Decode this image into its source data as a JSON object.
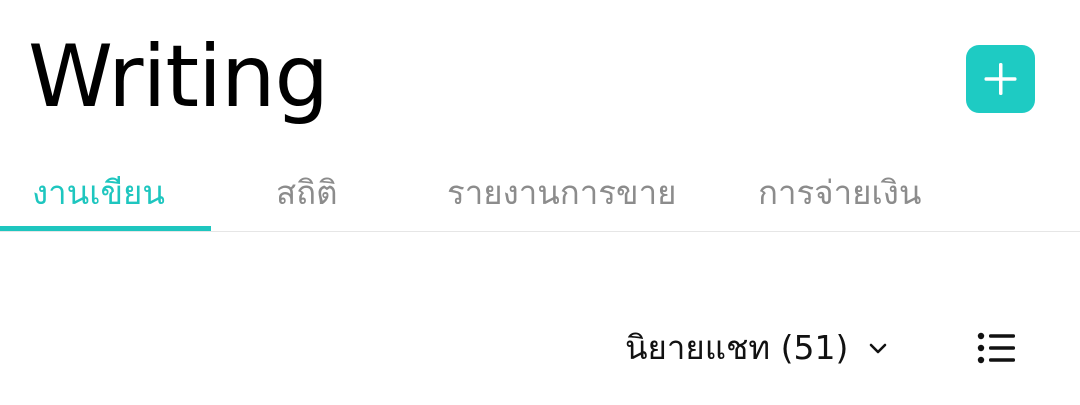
{
  "header": {
    "title": "Writing",
    "add_button_icon": "plus-icon",
    "accent_color": "#1ecbc3"
  },
  "tabs": [
    {
      "label": "งานเขียน",
      "active": true
    },
    {
      "label": "สถิติ",
      "active": false
    },
    {
      "label": "รายงานการขาย",
      "active": false
    },
    {
      "label": "การจ่ายเงิน",
      "active": false
    }
  ],
  "filter": {
    "selected": "นิยายแชท (51)",
    "icon": "chevron-down-icon"
  },
  "view_toggle": {
    "icon": "list-view-icon"
  }
}
